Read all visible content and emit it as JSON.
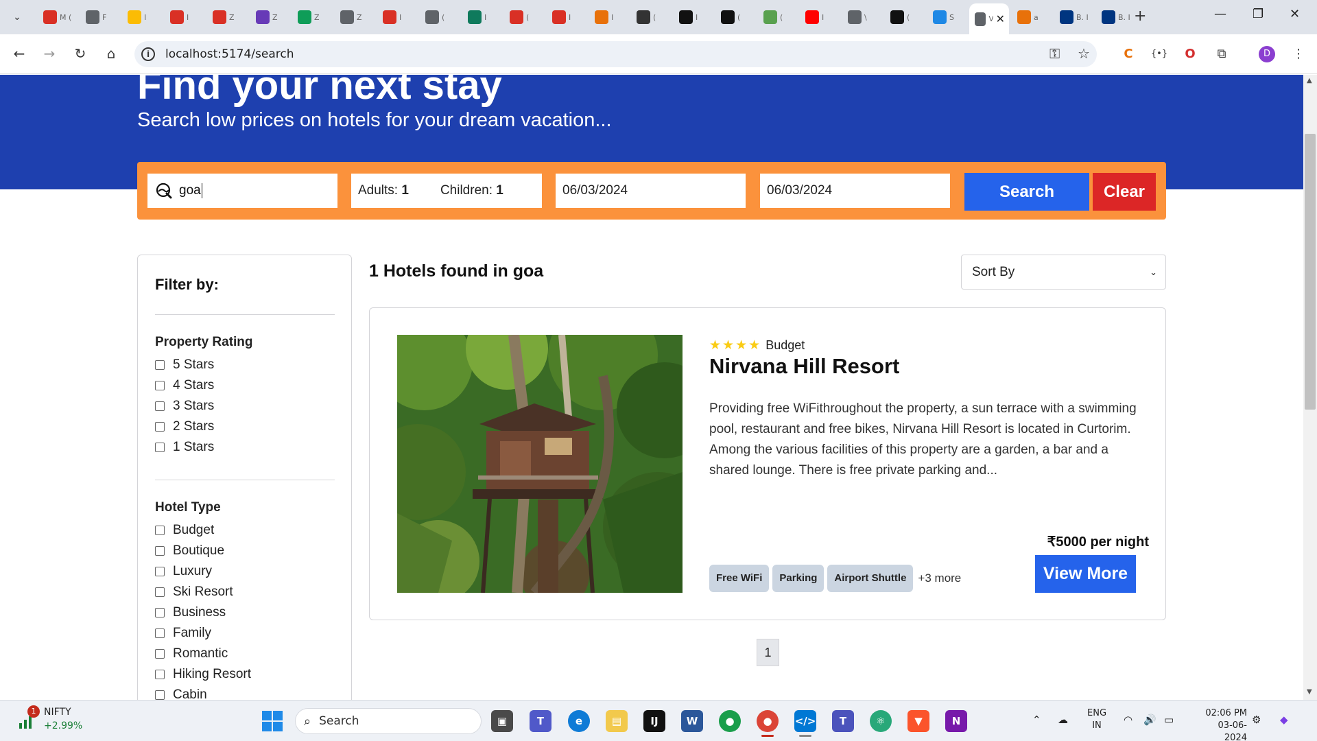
{
  "browser": {
    "tabs": [
      {
        "icon": "gmail-icon",
        "label": "M (",
        "color": "#d93025"
      },
      {
        "icon": "globe-icon",
        "label": "F",
        "color": "#5f6368"
      },
      {
        "icon": "drive-icon",
        "label": "I",
        "color": "#fbbc04"
      },
      {
        "icon": "gmail-icon",
        "label": "I",
        "color": "#d93025"
      },
      {
        "icon": "gmail-icon",
        "label": "Z",
        "color": "#d93025"
      },
      {
        "icon": "forms-icon",
        "label": "Z",
        "color": "#673ab7"
      },
      {
        "icon": "sheets-plus-icon",
        "label": "Z",
        "color": "#0f9d58"
      },
      {
        "icon": "globe-icon",
        "label": "Z",
        "color": "#5f6368"
      },
      {
        "icon": "gmail-icon",
        "label": "I",
        "color": "#d93025"
      },
      {
        "icon": "globe-icon",
        "label": "(",
        "color": "#5f6368"
      },
      {
        "icon": "rupee-icon",
        "label": "I",
        "color": "#0f7a5c"
      },
      {
        "icon": "gmail-icon",
        "label": "(",
        "color": "#d93025"
      },
      {
        "icon": "gmail-icon",
        "label": "I",
        "color": "#d93025"
      },
      {
        "icon": "hostel-icon",
        "label": "I",
        "color": "#e8710a"
      },
      {
        "icon": "openai-icon",
        "label": "(",
        "color": "#333333"
      },
      {
        "icon": "triangle-icon",
        "label": "I",
        "color": "#111111"
      },
      {
        "icon": "circle-c-icon",
        "label": "(",
        "color": "#111111"
      },
      {
        "icon": "flower-icon",
        "label": "(",
        "color": "#59a14f"
      },
      {
        "icon": "youtube-icon",
        "label": "I",
        "color": "#ff0000"
      },
      {
        "icon": "edit-icon",
        "label": "\\",
        "color": "#5f6368"
      },
      {
        "icon": "github-icon",
        "label": "(",
        "color": "#111111"
      },
      {
        "icon": "s-icon",
        "label": "S",
        "color": "#1e88e5"
      },
      {
        "icon": "v-icon",
        "label": "V",
        "color": "#5f6368"
      },
      {
        "icon": "scroll-icon",
        "label": "a",
        "color": "#e8710a"
      },
      {
        "icon": "booking-icon",
        "label": "B. I",
        "color": "#003580"
      },
      {
        "icon": "booking-icon",
        "label": "B. I",
        "color": "#003580"
      }
    ],
    "url": "localhost:5174/search"
  },
  "hero": {
    "title": "Find your next stay",
    "subtitle": "Search low prices on hotels for your dream vacation..."
  },
  "search": {
    "destination": "goa",
    "adults_label": "Adults:",
    "adults": "1",
    "children_label": "Children:",
    "children": "1",
    "check_in": "06/03/2024",
    "check_out": "06/03/2024",
    "search_label": "Search",
    "clear_label": "Clear"
  },
  "filters": {
    "title": "Filter by:",
    "rating_title": "Property Rating",
    "ratings": [
      "5 Stars",
      "4 Stars",
      "3 Stars",
      "2 Stars",
      "1 Stars"
    ],
    "type_title": "Hotel Type",
    "types": [
      "Budget",
      "Boutique",
      "Luxury",
      "Ski Resort",
      "Business",
      "Family",
      "Romantic",
      "Hiking Resort",
      "Cabin"
    ]
  },
  "results": {
    "summary": "1 Hotels found in goa",
    "sort_label": "Sort By",
    "hotels": [
      {
        "star_rating": 4,
        "type": "Budget",
        "name": "Nirvana Hill Resort",
        "description": "Providing free WiFithroughout the property, a sun terrace with a swimming pool, restaurant and free bikes, Nirvana Hill Resort is located in Curtorim. Among the various facilities of this property are a garden, a bar and a shared lounge. There is free private parking and...",
        "facilities": [
          "Free WiFi",
          "Parking",
          "Airport Shuttle"
        ],
        "more_facilities": "+3 more",
        "price": "₹5000 per night",
        "view_label": "View More"
      }
    ],
    "pages": [
      "1"
    ]
  },
  "taskbar": {
    "nifty_badge": "1",
    "nifty_name": "NIFTY",
    "nifty_change": "+2.99%",
    "search_placeholder": "Search",
    "lang_line1": "ENG",
    "lang_line2": "IN",
    "time": "02:06 PM",
    "date": "03-06-2024"
  }
}
